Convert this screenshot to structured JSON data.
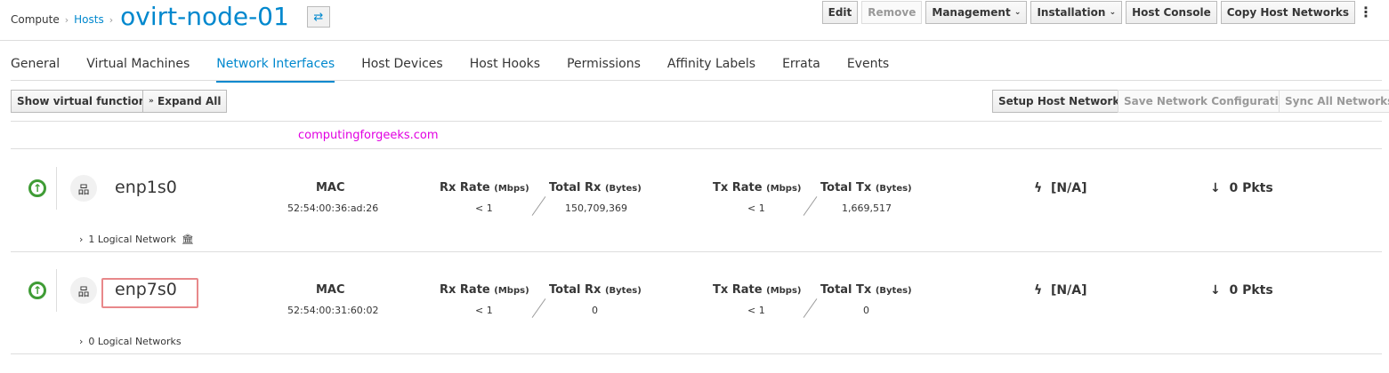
{
  "breadcrumb": {
    "items": [
      "Compute",
      "Hosts"
    ],
    "title": "ovirt-node-01"
  },
  "header_buttons": [
    "Edit",
    "Remove",
    "Management",
    "Installation",
    "Host Console",
    "Copy Host Networks"
  ],
  "tabs": [
    "General",
    "Virtual Machines",
    "Network Interfaces",
    "Host Devices",
    "Host Hooks",
    "Permissions",
    "Affinity Labels",
    "Errata",
    "Events"
  ],
  "active_tab": "Network Interfaces",
  "toolbar": {
    "show_vf": "Show virtual functions",
    "expand_all": "Expand All",
    "setup": "Setup Host Networks",
    "save": "Save Network Configuration",
    "sync": "Sync All Networks"
  },
  "watermark": "computingforgeeks.com",
  "labels": {
    "mac": "MAC",
    "rx_rate": "Rx Rate",
    "total_rx": "Total Rx",
    "tx_rate": "Tx Rate",
    "total_tx": "Total Tx",
    "mbps": "(Mbps)",
    "bytes": "(Bytes)"
  },
  "interfaces": [
    {
      "name": "enp1s0",
      "mac": "52:54:00:36:ad:26",
      "rx_rate": "< 1",
      "total_rx": "150,709,369",
      "tx_rate": "< 1",
      "total_tx": "1,669,517",
      "speed": "[N/A]",
      "drops": "0 Pkts",
      "logical": "1 Logical Network",
      "status": "up"
    },
    {
      "name": "enp7s0",
      "mac": "52:54:00:31:60:02",
      "rx_rate": "< 1",
      "total_rx": "0",
      "tx_rate": "< 1",
      "total_tx": "0",
      "speed": "[N/A]",
      "drops": "0 Pkts",
      "logical": "0 Logical Networks",
      "status": "up"
    }
  ],
  "colors": {
    "accent": "#0088ce",
    "up": "#3f9c35",
    "highlight": "#e8888a",
    "watermark": "#e100e1"
  }
}
